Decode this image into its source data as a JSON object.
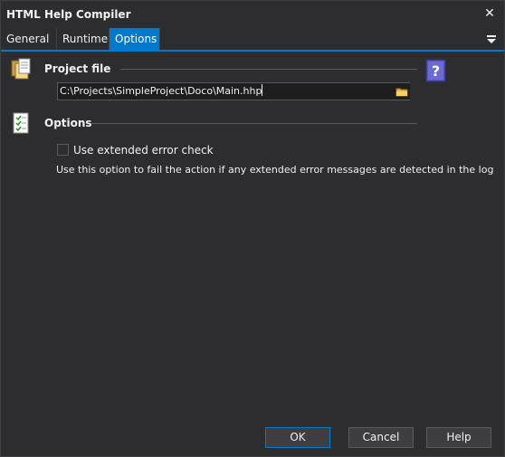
{
  "window": {
    "title": "HTML Help Compiler"
  },
  "tabs": [
    {
      "label": "General"
    },
    {
      "label": "Runtime"
    },
    {
      "label": "Options"
    }
  ],
  "project_file": {
    "title": "Project file",
    "path": "C:\\Projects\\SimpleProject\\Doco\\Main.hhp"
  },
  "options": {
    "title": "Options",
    "extended_error_label": "Use extended error check",
    "extended_error_checked": false,
    "description": "Use this option to fail the action if any extended error messages are detected in the log"
  },
  "buttons": {
    "ok": "OK",
    "cancel": "Cancel",
    "help": "Help"
  },
  "colors": {
    "accent": "#007acc",
    "background": "#2d2d30"
  }
}
